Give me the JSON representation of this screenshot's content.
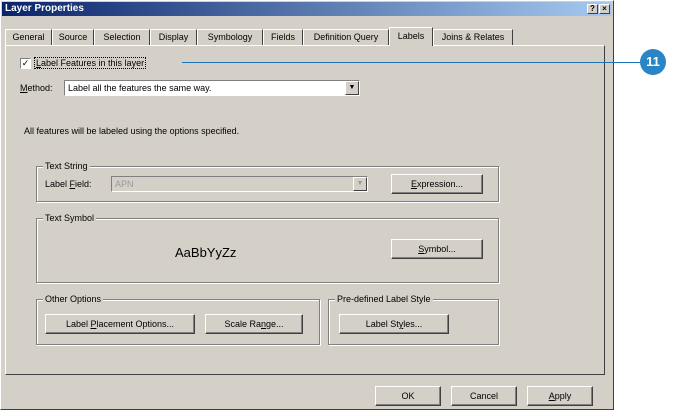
{
  "window": {
    "title": "Layer Properties",
    "help_glyph": "?",
    "close_glyph": "×"
  },
  "tabs": [
    {
      "label": "General"
    },
    {
      "label": "Source"
    },
    {
      "label": "Selection"
    },
    {
      "label": "Display"
    },
    {
      "label": "Symbology"
    },
    {
      "label": "Fields"
    },
    {
      "label": "Definition Query"
    },
    {
      "label": "Labels",
      "active": true
    },
    {
      "label": "Joins & Relates"
    }
  ],
  "labels_tab": {
    "label_features": {
      "checked": true,
      "check_glyph": "✓",
      "pre": "",
      "ul": "L",
      "post": "abel Features in this layer"
    },
    "method": {
      "pre": "",
      "ul": "M",
      "post": "ethod:",
      "value": "Label all the features the same way.",
      "arrow": "▼"
    },
    "description": "All features will be labeled using the options specified.",
    "text_string": {
      "legend": "Text String",
      "field_label_pre": "Label ",
      "field_label_ul": "F",
      "field_label_post": "ield:",
      "field_value": "APN",
      "arrow": "▼",
      "expression_pre": "",
      "expression_ul": "E",
      "expression_post": "xpression..."
    },
    "text_symbol": {
      "legend": "Text Symbol",
      "sample": "AaBbYyZz",
      "symbol_pre": "",
      "symbol_ul": "S",
      "symbol_post": "ymbol..."
    },
    "other_options": {
      "legend": "Other Options",
      "placement_pre": "Label ",
      "placement_ul": "P",
      "placement_post": "lacement Options...",
      "scale_pre": "Scale Ra",
      "scale_ul": "n",
      "scale_post": "ge..."
    },
    "predefined": {
      "legend": "Pre-defined Label Style",
      "styles_pre": "Label St",
      "styles_ul": "y",
      "styles_post": "les..."
    }
  },
  "footer": {
    "ok": "OK",
    "cancel": "Cancel",
    "apply_pre": "",
    "apply_ul": "A",
    "apply_post": "pply"
  },
  "callout": {
    "number": "11",
    "color": "#2a85c6"
  }
}
